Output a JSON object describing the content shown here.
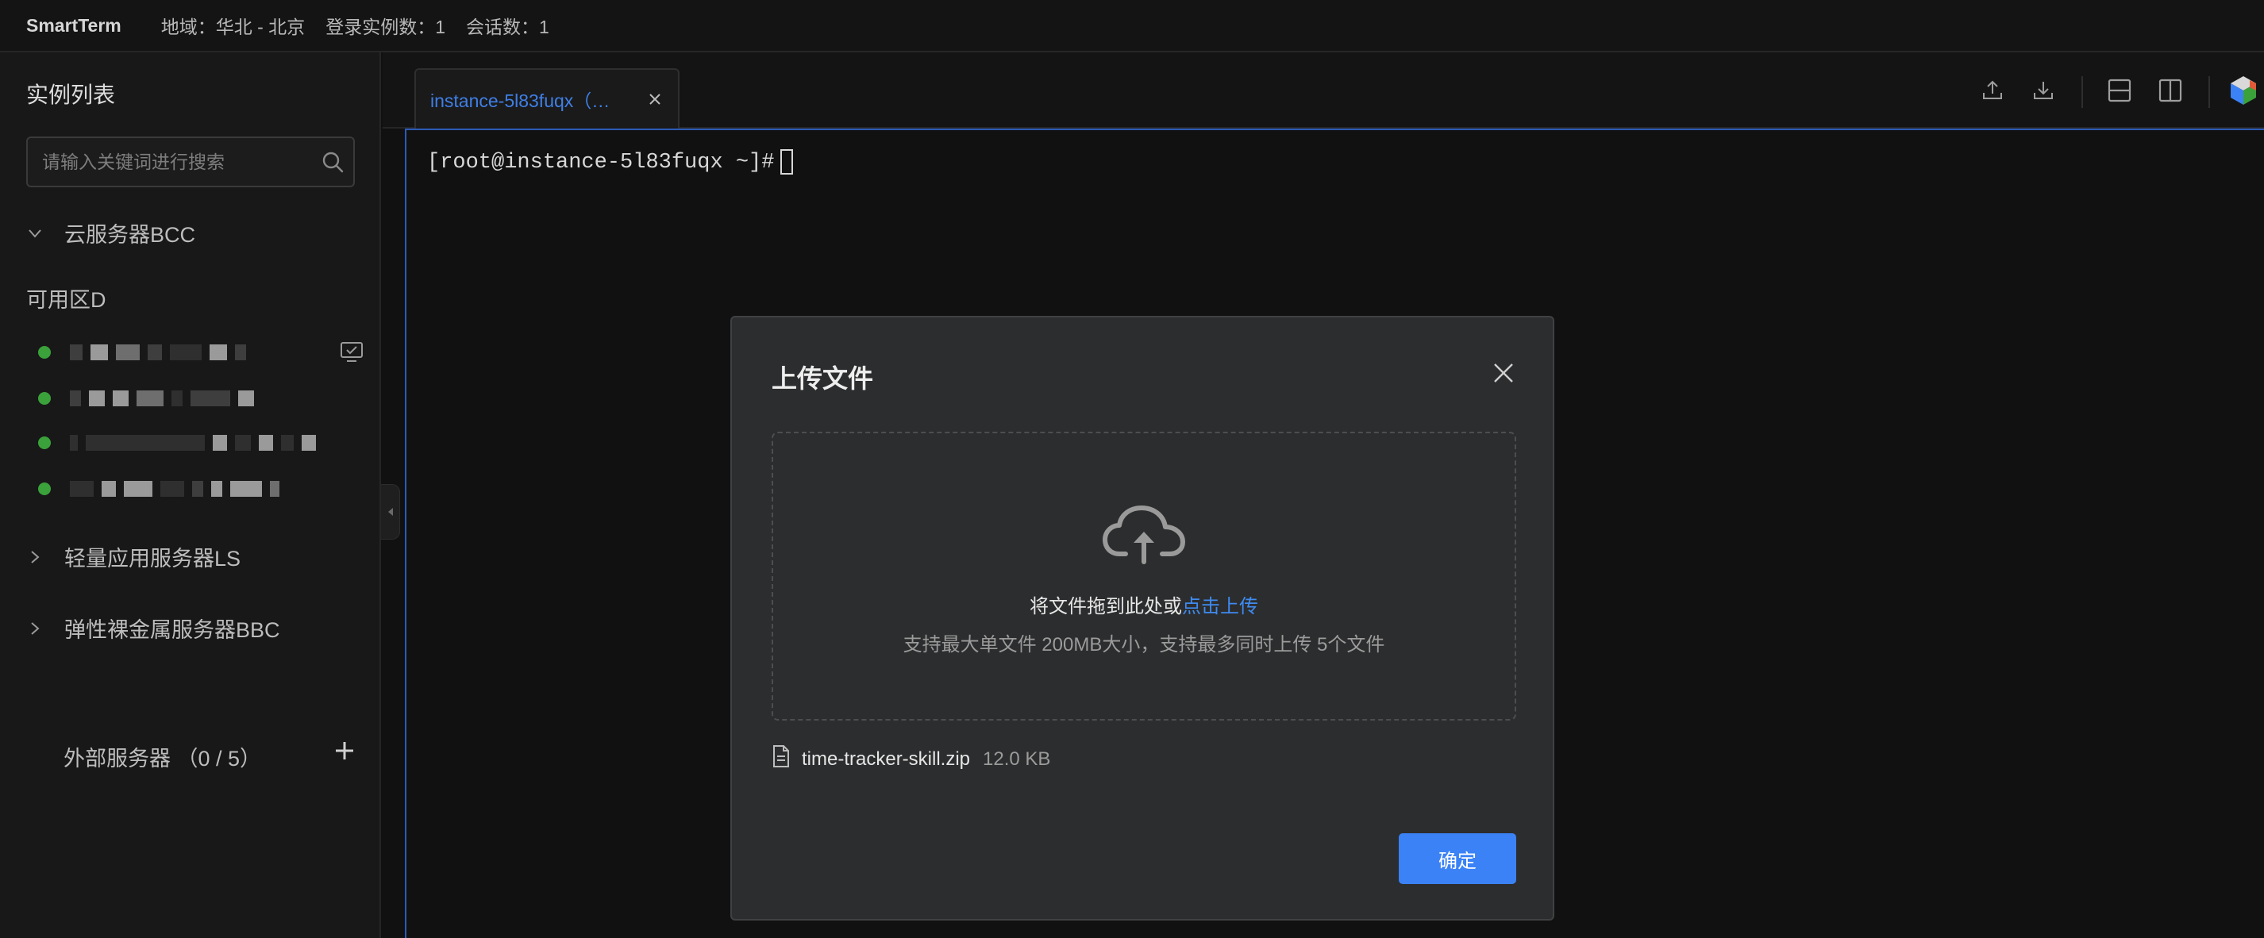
{
  "topbar": {
    "app_name": "SmartTerm",
    "region": "地域：华北 - 北京",
    "login_instances": "登录实例数：1",
    "sessions": "会话数：1"
  },
  "sidebar": {
    "title": "实例列表",
    "search_placeholder": "请输入关键词进行搜索",
    "groups": [
      {
        "label": "云服务器BCC",
        "expanded": true
      },
      {
        "label": "轻量应用服务器LS",
        "expanded": false
      },
      {
        "label": "弹性裸金属服务器BBC",
        "expanded": false
      }
    ],
    "zone": "可用区D",
    "instance_status_color": "#3ba13b",
    "external": "外部服务器 （0 / 5）"
  },
  "tabs": [
    {
      "label": "instance-5l83fuqx（…",
      "active": true
    }
  ],
  "terminal": {
    "prompt": "[root@instance-5l83fuqx ~]#"
  },
  "modal": {
    "title": "上传文件",
    "drop_text": "将文件拖到此处或",
    "drop_link": "点击上传",
    "hint": "支持最大单文件 200MB大小，支持最多同时上传 5个文件",
    "file": {
      "name": "time-tracker-skill.zip",
      "size": "12.0 KB"
    },
    "confirm_label": "确定"
  },
  "colors": {
    "accent": "#3b82f6",
    "link": "#3f8bf2",
    "status_running": "#3ba13b"
  }
}
